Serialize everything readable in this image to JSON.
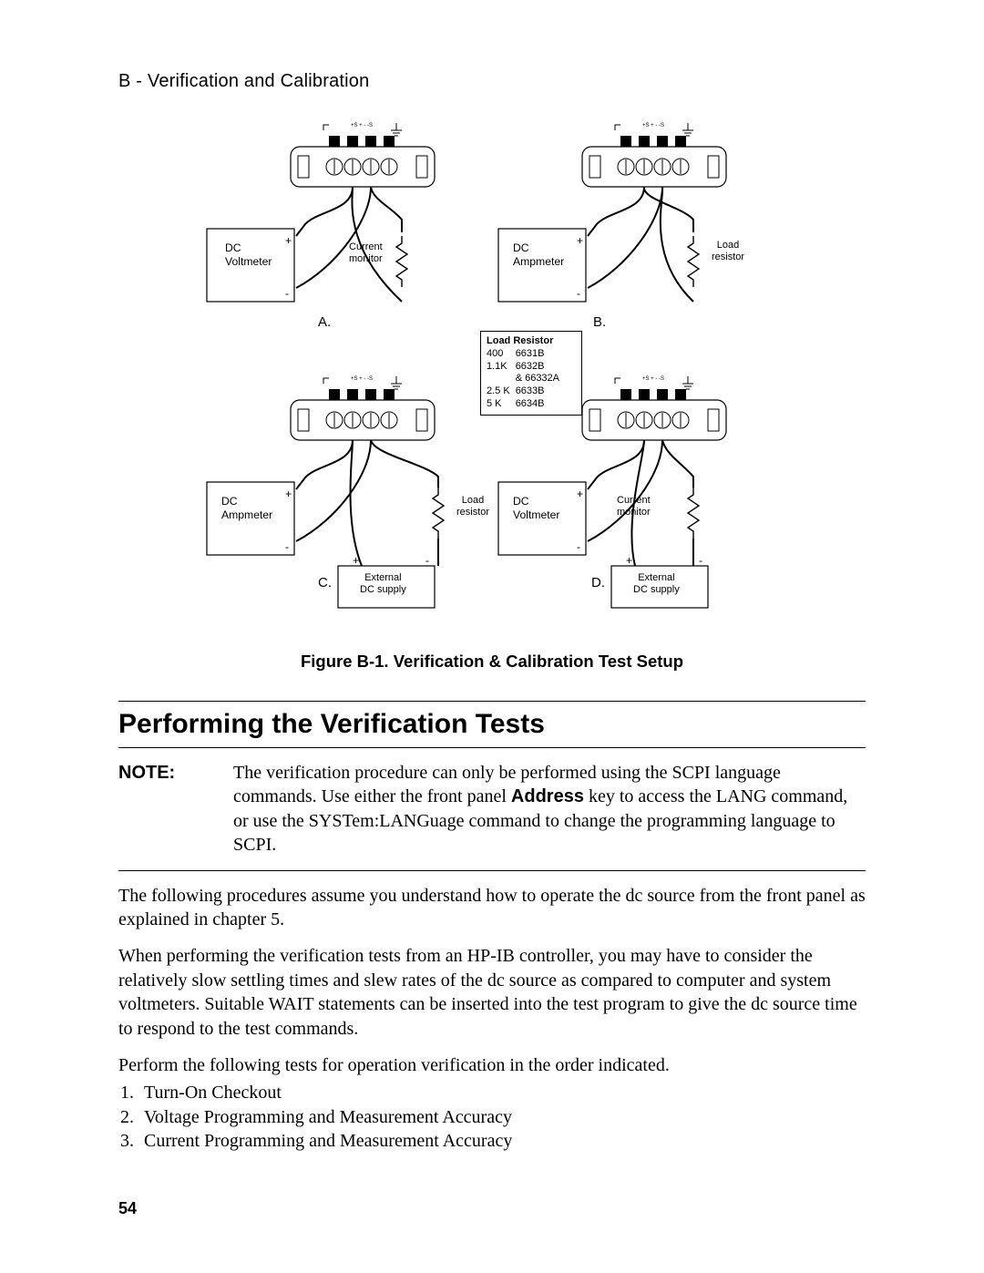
{
  "header": "B - Verification and Calibration",
  "figure_caption": "Figure B-1. Verification & Calibration Test Setup",
  "section_heading": "Performing the Verification Tests",
  "note_label": "NOTE:",
  "note_text_1": "The verification procedure can only be performed using the SCPI language commands. Use either the front panel ",
  "note_bold": "Address",
  "note_text_2": " key to access the LANG command, or use the SYSTem:LANGuage command to change the programming language to SCPI.",
  "paragraph1": "The following procedures assume you understand how to operate the dc source from the front panel as explained in chapter 5.",
  "paragraph2": "When performing the verification tests from an HP-IB controller, you may have to consider the relatively slow settling times and slew rates of the dc source as compared to computer and system voltmeters. Suitable WAIT statements can be inserted into the test program to give the  dc source time to respond to the test commands.",
  "paragraph3": "Perform the following tests for operation verification in the order indicated.",
  "test_items": [
    "Turn-On Checkout",
    "Voltage Programming and Measurement Accuracy",
    "Current Programming and Measurement Accuracy"
  ],
  "page_number": "54",
  "diagram": {
    "sections": {
      "A": "A.",
      "B": "B.",
      "C": "C.",
      "D": "D."
    },
    "meter_A": "DC\nVoltmeter",
    "meter_B": "DC\nAmpmeter",
    "meter_C": "DC\nAmpmeter",
    "meter_D": "DC\nVoltmeter",
    "current_monitor": "Current\nmonitor",
    "load_resistor": "Load\nresistor",
    "external_dc": "External\nDC supply",
    "plus": "+",
    "minus": "-",
    "load_resistor_box": {
      "title": "Load Resistor",
      "rows": [
        [
          "400",
          "6631B"
        ],
        [
          "1.1K",
          "6632B"
        ],
        [
          "",
          "& 66332A"
        ],
        [
          "2.5 K",
          "6633B"
        ],
        [
          "5 K",
          "6634B"
        ]
      ]
    },
    "terminal_header": "+S  +   -  -S",
    "ampmeter_hint": ""
  }
}
